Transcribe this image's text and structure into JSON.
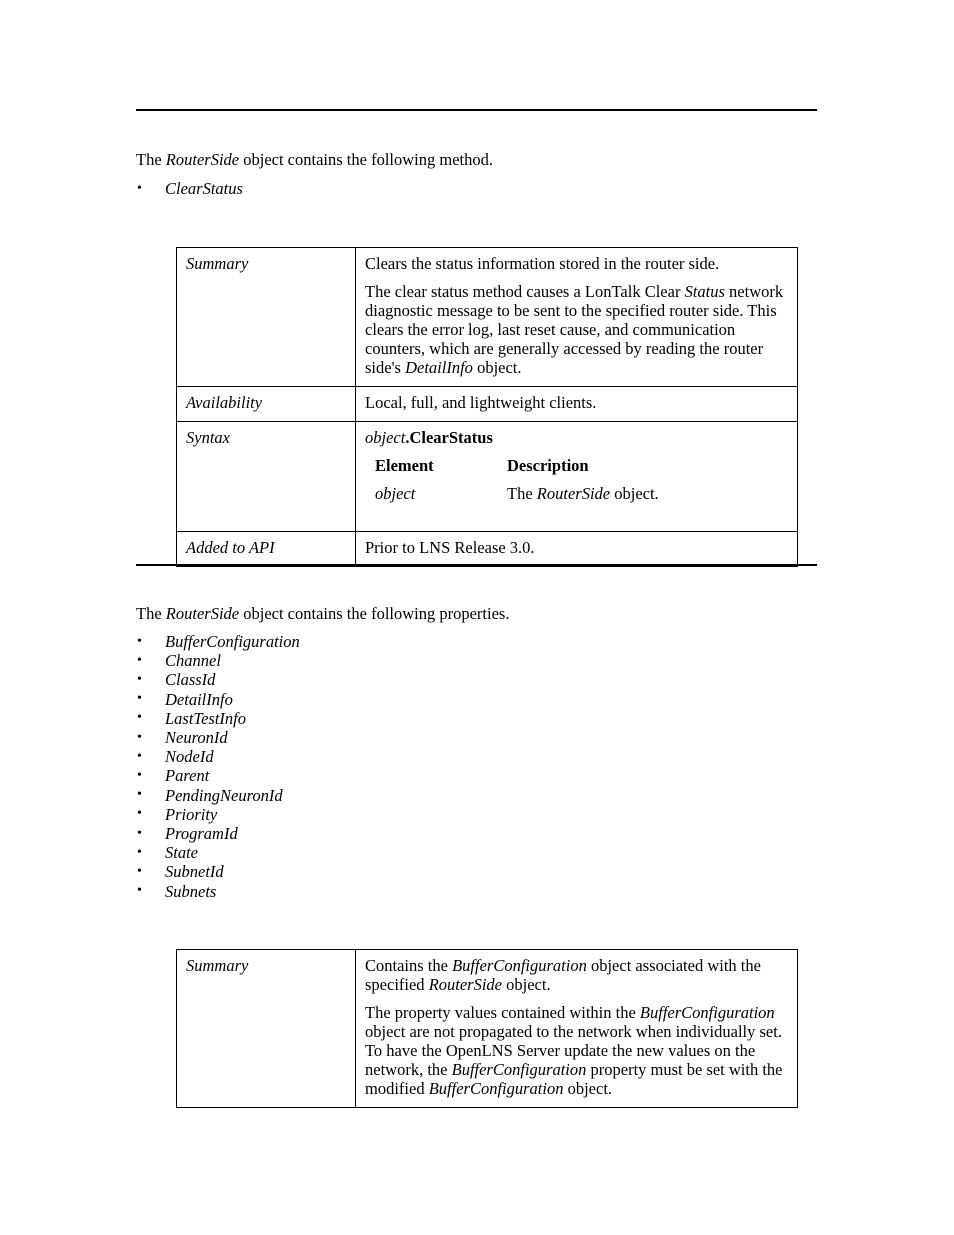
{
  "document": {
    "sections": [
      {
        "id": "method-section",
        "intro_prefix": "The ",
        "intro_italic": "RouterSide",
        "intro_suffix": " object contains the following method.",
        "items": [
          "ClearStatus"
        ]
      },
      {
        "id": "properties-section",
        "intro_prefix": "The ",
        "intro_italic": "RouterSide",
        "intro_suffix": " object contains the following properties.",
        "items": [
          "BufferConfiguration",
          "Channel",
          "ClassId",
          "DetailInfo",
          "LastTestInfo",
          "NeuronId",
          "NodeId",
          "Parent",
          "PendingNeuronId",
          "Priority",
          "ProgramId",
          "State",
          "SubnetId",
          "Subnets"
        ]
      }
    ],
    "tables": {
      "clearstatus": {
        "rows": {
          "summary": {
            "label": "Summary",
            "paragraph_1": "Clears the status information stored in the router side.",
            "paragraph_2_part_1": "The clear status method causes a LonTalk Clear ",
            "paragraph_2_italic_1": "Status",
            "paragraph_2_part_2": " network diagnostic message to be sent to the specified router side.  This clears the error log, last reset cause, and communication counters, which are generally accessed by reading the router side's ",
            "paragraph_2_italic_2": "DetailInfo",
            "paragraph_2_part_3": " object."
          },
          "availability": {
            "label": "Availability",
            "value": "Local, full, and lightweight clients."
          },
          "syntax": {
            "label": "Syntax",
            "signature_object": "object",
            "signature_separator": ".",
            "signature_member": "ClearStatus",
            "header_element": "Element",
            "header_description": "Description",
            "element_name": "object",
            "element_description_prefix": "The ",
            "element_description_italic": "RouterSide",
            "element_description_suffix": "  object."
          },
          "added_to_api": {
            "label": "Added to API",
            "value": "Prior to LNS Release 3.0."
          }
        }
      },
      "bufferconfiguration": {
        "rows": {
          "summary": {
            "label": "Summary",
            "paragraph_1_part_1": "Contains the ",
            "paragraph_1_italic_1": "BufferConfiguration",
            "paragraph_1_part_2": " object associated with the specified ",
            "paragraph_1_italic_2": "RouterSide",
            "paragraph_1_part_3": " object.",
            "paragraph_2_part_1": "The property values contained within the ",
            "paragraph_2_italic_1": "BufferConfiguration",
            "paragraph_2_part_2": " object are not propagated to the network when individually set.  To have the OpenLNS Server update the new values on the network, the ",
            "paragraph_2_italic_2": "BufferConfiguration",
            "paragraph_2_part_3": " property must be set with the modified ",
            "paragraph_2_italic_3": "BufferConfiguration",
            "paragraph_2_part_4": " object."
          }
        }
      }
    }
  }
}
